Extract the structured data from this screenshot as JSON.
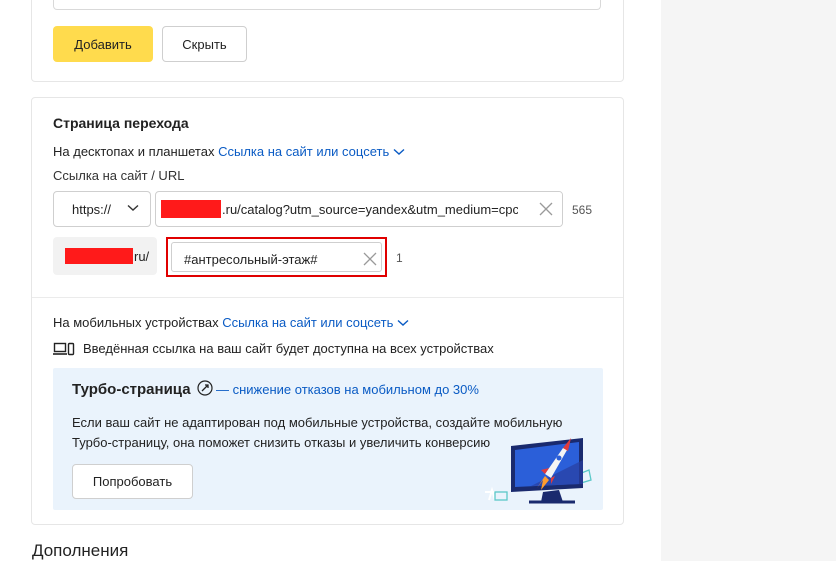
{
  "form": {
    "add_button": "Добавить",
    "hide_button": "Скрыть"
  },
  "landing": {
    "title": "Страница перехода",
    "desktop_label": "На десктопах и планшетах",
    "desktop_link": "Ссылка на сайт или соцсеть",
    "url_label": "Ссылка на сайт / URL",
    "protocol": "https://",
    "url_value": ".ru/catalog?utm_source=yandex&utm_medium=cpc&",
    "url_counter": "565",
    "domain_suffix": "ru/",
    "anchor_value": "#антресольный-этаж#",
    "anchor_counter": "1",
    "mobile_label": "На мобильных устройствах",
    "mobile_link": "Ссылка на сайт или соцсеть",
    "devices_note": "Введённая ссылка на ваш сайт будет доступна на всех устройствах"
  },
  "turbo": {
    "title": "Турбо-страница",
    "subtitle": "— снижение отказов на мобильном до 30%",
    "description": "Если ваш сайт не адаптирован под мобильные устройства, создайте мобильную Турбо-страницу, она поможет снизить отказы и увеличить конверсию",
    "try_button": "Попробовать"
  },
  "additions": {
    "title": "Дополнения"
  },
  "colors": {
    "accent_yellow": "#ffdb4d",
    "link_blue": "#0a5bc4",
    "highlight_red": "#e00000",
    "turbo_bg": "#eaf3fc"
  },
  "icons": [
    "chevron-down-icon",
    "clear-icon",
    "devices-icon",
    "rocket-icon",
    "monitor-rocket-illustration"
  ]
}
